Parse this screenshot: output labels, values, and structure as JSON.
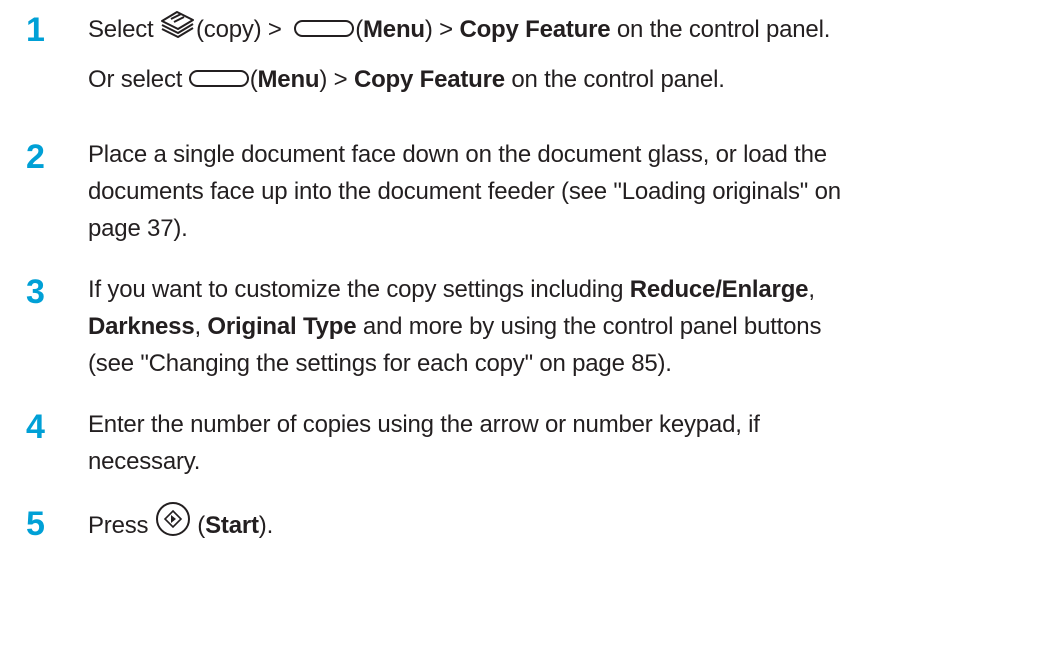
{
  "steps": [
    {
      "number": "1",
      "line1": {
        "select": "Select ",
        "copy_label": "(copy) > ",
        "paren_open": "(",
        "menu": "Menu",
        "paren_close": ")",
        "sep": " > ",
        "copy_feature": "Copy Feature",
        "tail": " on the control panel."
      },
      "line2": {
        "or_select": "Or select ",
        "paren_open": "(",
        "menu": "Menu",
        "paren_close": ")",
        "sep": " > ",
        "copy_feature": "Copy Feature",
        "tail": " on the control panel."
      }
    },
    {
      "number": "2",
      "lines": [
        "Place a single document face down on the document glass, or load the",
        "documents face up into the document feeder (see \"Loading originals\" on",
        "page 37)."
      ]
    },
    {
      "number": "3",
      "l1_pre": "If you want to customize the copy settings including ",
      "reduce_enlarge": "Reduce/Enlarge",
      "comma1": ",",
      "darkness": "Darkness",
      "comma2": ", ",
      "original_type": "Original Type",
      "l2_tail": " and more by using the control panel buttons",
      "l3": "(see \"Changing the settings for each copy\" on page 85)."
    },
    {
      "number": "4",
      "lines": [
        "Enter the number of copies using the arrow or number keypad, if",
        "necessary."
      ]
    },
    {
      "number": "5",
      "press": "Press ",
      "paren_open": " (",
      "start": "Start",
      "paren_close": ")."
    }
  ],
  "icons": {
    "copy": "copy-icon",
    "menu": "menu-button-icon",
    "start": "start-button-icon"
  },
  "colors": {
    "step_number": "#00a0d6",
    "text": "#231f20"
  }
}
